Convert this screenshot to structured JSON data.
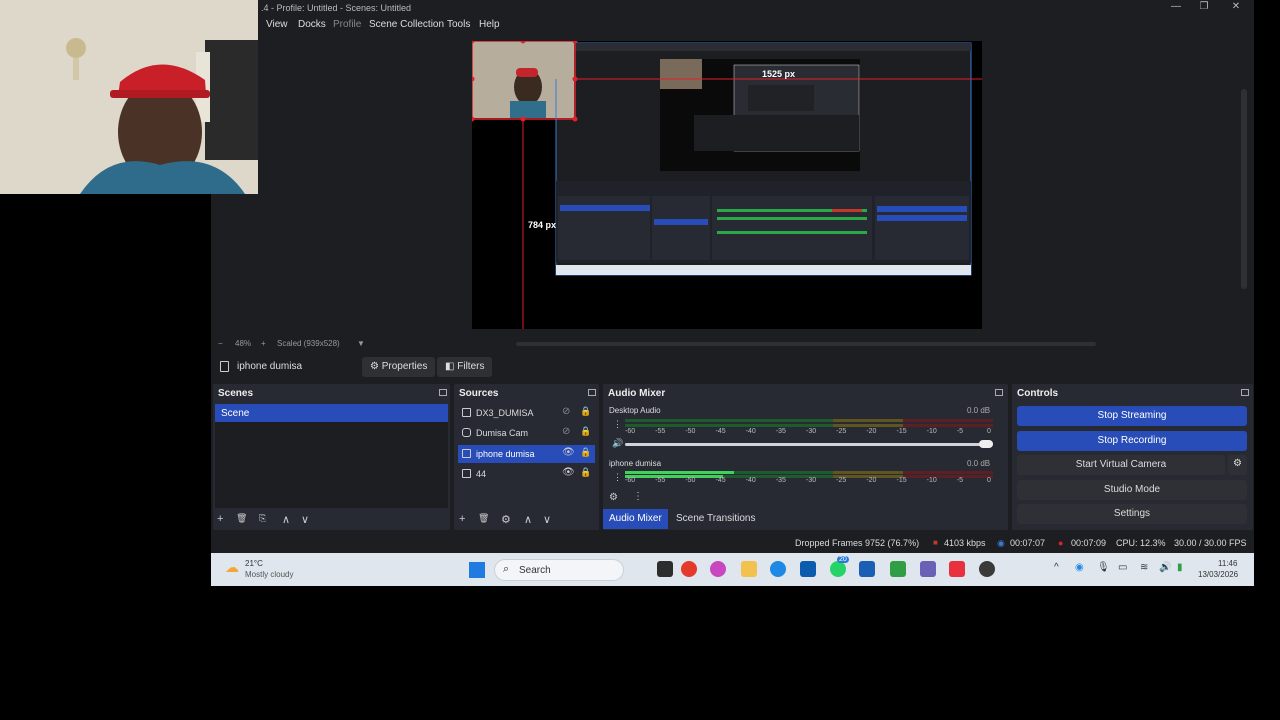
{
  "window": {
    "title": ".4 - Profile: Untitled - Scenes: Untitled",
    "minimize": "—",
    "restore": "❐",
    "close": "✕"
  },
  "menu": [
    "View",
    "Docks",
    "Profile",
    "Scene Collection",
    "Tools",
    "Help"
  ],
  "preview": {
    "width_label": "1525 px",
    "height_label": "784 px"
  },
  "zoom": {
    "minus": "−",
    "level": "48%",
    "plus": "+",
    "scaled": "Scaled (939x528)",
    "dropdown": "▼"
  },
  "context": {
    "source_name": "iphone dumisa",
    "properties": "Properties",
    "filters": "Filters"
  },
  "scenes": {
    "header": "Scenes",
    "items": [
      "Scene"
    ],
    "toolbar": [
      "+",
      "🗑",
      "⎘",
      "∧",
      "∨"
    ]
  },
  "sources": {
    "header": "Sources",
    "items": [
      {
        "name": "DX3_DUMISA",
        "visible": false,
        "selected": false
      },
      {
        "name": "Dumisa Cam",
        "visible": false,
        "selected": false
      },
      {
        "name": "iphone dumisa",
        "visible": true,
        "selected": true
      },
      {
        "name": "44",
        "visible": true,
        "selected": false
      }
    ],
    "toolbar": [
      "+",
      "🗑",
      "⚙",
      "∧",
      "∨"
    ]
  },
  "mixer": {
    "header": "Audio Mixer",
    "channels": [
      {
        "name": "Desktop Audio",
        "db": "0.0 dB",
        "level": 0.0
      },
      {
        "name": "iphone dumisa",
        "db": "0.0 dB",
        "level": 0.35
      }
    ],
    "scale": [
      "-60",
      "-55",
      "-50",
      "-45",
      "-40",
      "-35",
      "-30",
      "-25",
      "-20",
      "-15",
      "-10",
      "-5",
      "0"
    ],
    "tabs": [
      "Audio Mixer",
      "Scene Transitions"
    ]
  },
  "controls": {
    "header": "Controls",
    "buttons": [
      "Stop Streaming",
      "Stop Recording",
      "Start Virtual Camera",
      "Studio Mode",
      "Settings"
    ]
  },
  "status": {
    "dropped": "Dropped Frames 9752 (76.7%)",
    "bitrate": "4103 kbps",
    "stream_time": "00:07:07",
    "rec_time": "00:07:09",
    "cpu": "CPU: 12.3%",
    "fps": "30.00 / 30.00 FPS"
  },
  "taskbar": {
    "weather_temp": "21°C",
    "weather_desc": "Mostly cloudy",
    "search": "Search",
    "badge": "20",
    "time": "11:46",
    "date": "13/03/2026"
  },
  "colors": {
    "accent": "#284cb8",
    "panel": "#272a33",
    "bg": "#1d1e21",
    "selection": "#e0202a"
  }
}
